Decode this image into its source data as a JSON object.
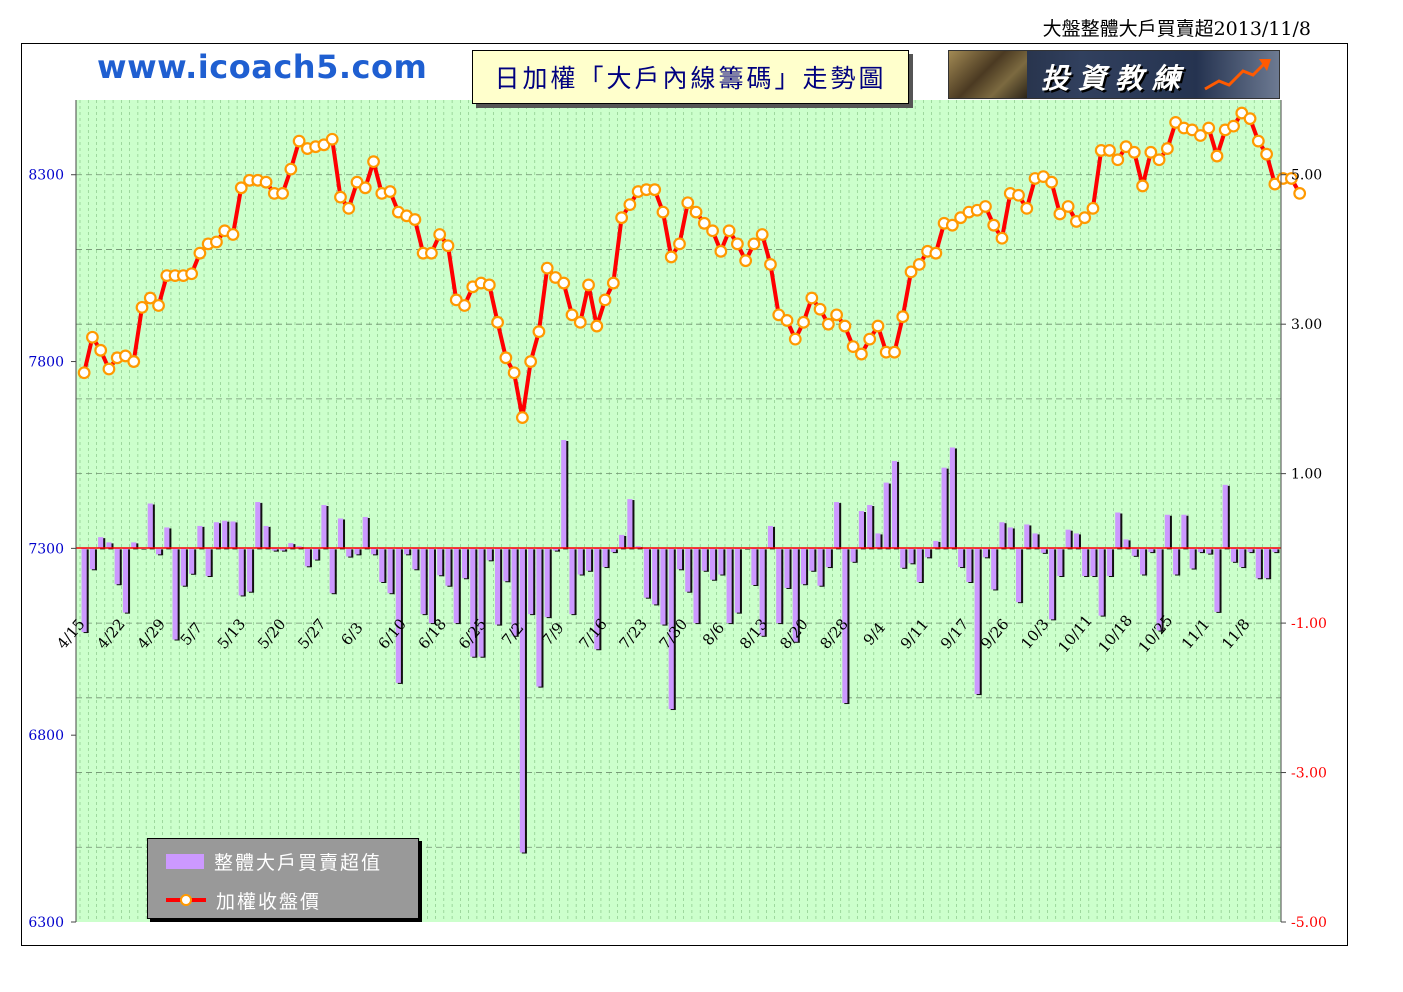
{
  "header": {
    "top_title": "大盤整體大戶買賣超2013/11/8",
    "site": "www.icoach5.com",
    "chart_title": "日加權「大戶內線籌碼」走勢圖",
    "banner_text": "投資教練"
  },
  "legend": {
    "bar_label": "整體大戶買賣超值",
    "line_label": "加權收盤價"
  },
  "colors": {
    "plot_bg": "#ccffcc",
    "bar_color": "#cc99ff",
    "bar_shadow": "#111111",
    "line_color": "#ff0000",
    "marker_fill": "#ffffff",
    "marker_stroke": "#ff9900",
    "zero_line": "#ff0000",
    "left_axis_text": "#0000cc",
    "right_axis_text_positive": "#000000",
    "right_axis_text_negative": "#ff0000"
  },
  "chart_data": {
    "type": "bar+line",
    "left_axis": {
      "ylim": [
        6300,
        8500
      ],
      "ticks": [
        6300,
        6800,
        7300,
        7800,
        8300
      ]
    },
    "right_axis": {
      "ylim": [
        -5,
        6
      ],
      "ticks": [
        "5.00",
        "3.00",
        "1.00",
        "-1.00",
        "-3.00",
        "-5.00"
      ],
      "values": [
        5,
        3,
        1,
        -1,
        -3,
        -5
      ]
    },
    "x_tick_labels": [
      "4/15",
      "4/22",
      "4/29",
      "5/7",
      "5/13",
      "5/20",
      "5/27",
      "6/3",
      "6/10",
      "6/18",
      "6/25",
      "7/2",
      "7/9",
      "7/16",
      "7/23",
      "7/30",
      "8/6",
      "8/13",
      "8/20",
      "8/28",
      "9/4",
      "9/11",
      "9/17",
      "9/26",
      "10/3",
      "10/11",
      "10/18",
      "10/25",
      "11/1",
      "11/8"
    ],
    "series": [
      {
        "name": "整體大戶買賣超值",
        "kind": "bar",
        "axis": "right",
        "values": [
          -1.12,
          -0.28,
          0.15,
          0.08,
          -0.48,
          -0.86,
          0.08,
          0.0,
          0.6,
          -0.08,
          0.28,
          -1.22,
          -0.5,
          -0.34,
          0.3,
          -0.37,
          0.35,
          0.37,
          0.36,
          -0.63,
          -0.58,
          0.62,
          0.3,
          -0.03,
          -0.03,
          0.07,
          0.03,
          -0.24,
          -0.15,
          0.58,
          -0.6,
          0.4,
          -0.11,
          -0.08,
          0.42,
          -0.08,
          -0.45,
          -0.6,
          -1.8,
          -0.08,
          -0.28,
          -0.88,
          -1.0,
          -0.36,
          -0.5,
          -1.0,
          -0.4,
          -1.45,
          -1.45,
          -0.16,
          -1.02,
          -0.44,
          -1.17,
          -4.07,
          -0.88,
          -1.85,
          -0.92,
          -0.03,
          1.45,
          -0.88,
          -0.35,
          -0.3,
          -1.35,
          -0.25,
          -0.05,
          0.18,
          0.66,
          0.03,
          -0.66,
          -0.75,
          -1.02,
          -2.15,
          -0.28,
          -0.58,
          -1.0,
          -0.3,
          -0.42,
          -0.35,
          -1.0,
          -0.86,
          0.0,
          -0.49,
          -1.17,
          0.3,
          -1.0,
          -0.53,
          -1.25,
          -0.48,
          -0.3,
          -0.5,
          -0.25,
          0.62,
          -2.07,
          -0.18,
          0.5,
          0.58,
          0.2,
          0.88,
          1.17,
          -0.26,
          -0.2,
          -0.45,
          -0.12,
          0.1,
          1.08,
          1.35,
          -0.25,
          -0.45,
          -1.95,
          -0.12,
          -0.55,
          0.35,
          0.28,
          -0.72,
          0.32,
          0.2,
          -0.06,
          -0.95,
          -0.37,
          0.25,
          0.2,
          -0.37,
          -0.37,
          -0.9,
          -0.37,
          0.48,
          0.12,
          -0.1,
          -0.35,
          -0.05,
          -1.1,
          0.45,
          -0.35,
          0.45,
          -0.27,
          -0.05,
          -0.07,
          -0.85,
          0.85,
          -0.18,
          -0.25,
          -0.05,
          -0.4,
          -0.4,
          -0.05
        ]
      },
      {
        "name": "加權收盤價",
        "kind": "line",
        "axis": "left",
        "values": [
          7770,
          7865,
          7830,
          7780,
          7810,
          7815,
          7800,
          7945,
          7970,
          7950,
          8030,
          8030,
          8030,
          8035,
          8090,
          8115,
          8120,
          8150,
          8140,
          8265,
          8285,
          8285,
          8280,
          8250,
          8250,
          8315,
          8390,
          8370,
          8375,
          8380,
          8395,
          8240,
          8210,
          8280,
          8265,
          8335,
          8250,
          8255,
          8200,
          8190,
          8180,
          8090,
          8090,
          8140,
          8110,
          7965,
          7950,
          8000,
          8010,
          8005,
          7905,
          7810,
          7770,
          7650,
          7800,
          7880,
          8050,
          8025,
          8010,
          7925,
          7905,
          8005,
          7895,
          7965,
          8010,
          8185,
          8220,
          8255,
          8260,
          8260,
          8200,
          8080,
          8115,
          8225,
          8200,
          8170,
          8150,
          8095,
          8150,
          8115,
          8070,
          8115,
          8140,
          8060,
          7925,
          7910,
          7860,
          7905,
          7970,
          7940,
          7900,
          7925,
          7895,
          7840,
          7820,
          7860,
          7895,
          7825,
          7825,
          7920,
          8040,
          8060,
          8095,
          8090,
          8170,
          8165,
          8185,
          8200,
          8205,
          8215,
          8165,
          8130,
          8250,
          8245,
          8210,
          8290,
          8295,
          8280,
          8195,
          8215,
          8175,
          8185,
          8210,
          8365,
          8365,
          8340,
          8375,
          8360,
          8270,
          8360,
          8340,
          8370,
          8440,
          8425,
          8420,
          8405,
          8425,
          8350,
          8420,
          8430,
          8465,
          8450,
          8390,
          8355,
          8275,
          8290,
          8290,
          8250
        ]
      }
    ],
    "grid": true
  }
}
